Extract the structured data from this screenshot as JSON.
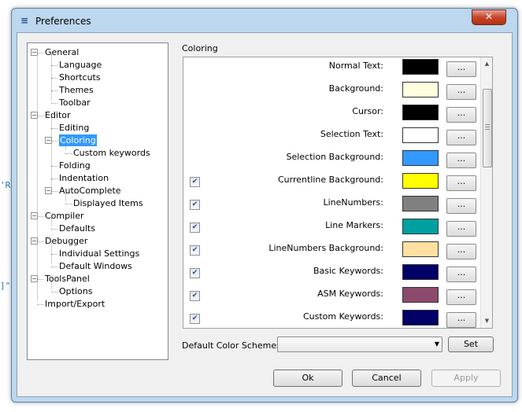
{
  "background_fragments": [
    "'R",
    "]\""
  ],
  "window": {
    "title": "Preferences",
    "close_label": "✕"
  },
  "tree": {
    "items": [
      {
        "label": "General",
        "expander": "−"
      },
      {
        "label": "Language"
      },
      {
        "label": "Shortcuts"
      },
      {
        "label": "Themes"
      },
      {
        "label": "Toolbar"
      },
      {
        "label": "Editor",
        "expander": "−"
      },
      {
        "label": "Editing"
      },
      {
        "label": "Coloring",
        "expander": "−",
        "selected": true
      },
      {
        "label": "Custom keywords"
      },
      {
        "label": "Folding"
      },
      {
        "label": "Indentation"
      },
      {
        "label": "AutoComplete",
        "expander": "−"
      },
      {
        "label": "Displayed Items"
      },
      {
        "label": "Compiler",
        "expander": "−"
      },
      {
        "label": "Defaults"
      },
      {
        "label": "Debugger",
        "expander": "−"
      },
      {
        "label": "Individual Settings"
      },
      {
        "label": "Default Windows"
      },
      {
        "label": "ToolsPanel",
        "expander": "−"
      },
      {
        "label": "Options"
      },
      {
        "label": "Import/Export"
      }
    ]
  },
  "coloring": {
    "group_label": "Coloring",
    "button_label": "...",
    "rows": [
      {
        "label": "Normal Text:",
        "color": "#000000",
        "checkbox": false
      },
      {
        "label": "Background:",
        "color": "#ffffe0",
        "checkbox": false
      },
      {
        "label": "Cursor:",
        "color": "#000000",
        "checkbox": false
      },
      {
        "label": "Selection Text:",
        "color": "#ffffff",
        "checkbox": false
      },
      {
        "label": "Selection Background:",
        "color": "#3399ff",
        "checkbox": false
      },
      {
        "label": "Currentline Background:",
        "color": "#ffff00",
        "checkbox": true,
        "checked": true
      },
      {
        "label": "LineNumbers:",
        "color": "#808080",
        "checkbox": true,
        "checked": true
      },
      {
        "label": "Line Markers:",
        "color": "#00a0a0",
        "checkbox": true,
        "checked": true
      },
      {
        "label": "LineNumbers Background:",
        "color": "#ffe0a0",
        "checkbox": true,
        "checked": true
      },
      {
        "label": "Basic Keywords:",
        "color": "#000066",
        "checkbox": true,
        "checked": true
      },
      {
        "label": "ASM Keywords:",
        "color": "#8b4a6b",
        "checkbox": true,
        "checked": true
      },
      {
        "label": "Custom Keywords:",
        "color": "#000066",
        "checkbox": true,
        "checked": true
      }
    ]
  },
  "scheme": {
    "label": "Default Color Schemes:",
    "selected_value": "",
    "set_label": "Set"
  },
  "footer": {
    "ok_label": "Ok",
    "cancel_label": "Cancel",
    "apply_label": "Apply"
  }
}
